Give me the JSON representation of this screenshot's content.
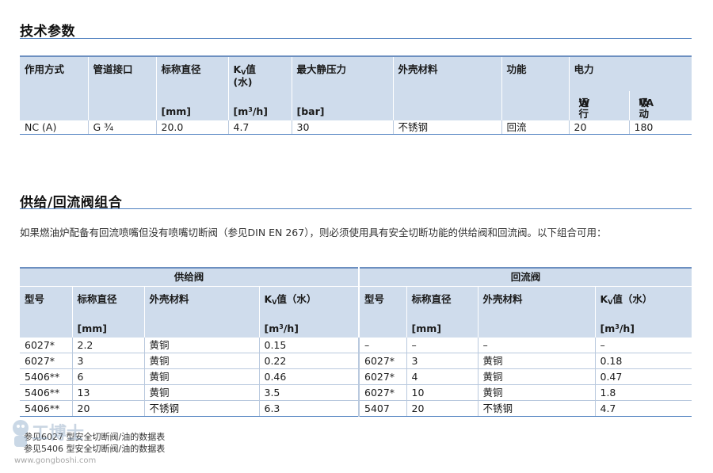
{
  "section1": {
    "title": "技术参数"
  },
  "tech_table": {
    "headers": {
      "mode": "作用方式",
      "port": "管道接口",
      "dn": "标称直径",
      "dn_unit": "[mm]",
      "kv_k": "K",
      "kv_sub": "V",
      "kv_rest": "值",
      "kv_water": "(水)",
      "kv_unit_a": "[m",
      "kv_unit_sup": "3",
      "kv_unit_b": "/h]",
      "pressure": "最大静压力",
      "pressure_unit": "[bar]",
      "material": "外壳材料",
      "function": "功能",
      "power": "电力",
      "run_label": "运行",
      "run_unit": "W",
      "pull_label": "吸动",
      "pull_unit": "VA"
    },
    "row": [
      "NC (A)",
      "G ¾",
      "20.0",
      "4.7",
      "30",
      "不锈钢",
      "回流",
      "20",
      "180"
    ]
  },
  "section2": {
    "title": "供给/回流阀组合",
    "intro": "如果燃油炉配备有回流喷嘴但没有喷嘴切断阀（参见DIN EN 267），则必须使用具有安全切断功能的供给阀和回流阀。以下组合可用："
  },
  "combo_table": {
    "group_supply": "供给阀",
    "group_return": "回流阀",
    "headers": {
      "model": "型号",
      "dn": "标称直径",
      "dn_unit": "[mm]",
      "material": "外壳材料",
      "kv_k": "K",
      "kv_sub": "V",
      "kv_rest": "值（水）",
      "kv_unit_a": "[m",
      "kv_unit_sup": "3",
      "kv_unit_b": "/h]"
    },
    "rows": [
      [
        "6027*",
        "2.2",
        "黄铜",
        "0.15",
        "–",
        "–",
        "–",
        "–"
      ],
      [
        "6027*",
        "3",
        "黄铜",
        "0.22",
        "6027*",
        "3",
        "黄铜",
        "0.18"
      ],
      [
        "5406**",
        "6",
        "黄铜",
        "0.46",
        "6027*",
        "4",
        "黄铜",
        "0.47"
      ],
      [
        "5406**",
        "13",
        "黄铜",
        "3.5",
        "6027*",
        "10",
        "黄铜",
        "1.8"
      ],
      [
        "5406**",
        "20",
        "不锈钢",
        "6.3",
        "5407",
        "20",
        "不锈钢",
        "4.7"
      ]
    ]
  },
  "footnotes": {
    "f1": "参见6027 型安全切断阀/油的数据表",
    "f2": "参见5406 型安全切断阀/油的数据表"
  },
  "watermark": {
    "brand": "工博士",
    "url": "www.gongboshi.com"
  },
  "colors": {
    "header_bg": "#cfdcec",
    "rule": "#4d7fbf",
    "cell_border": "#b9c9de"
  }
}
